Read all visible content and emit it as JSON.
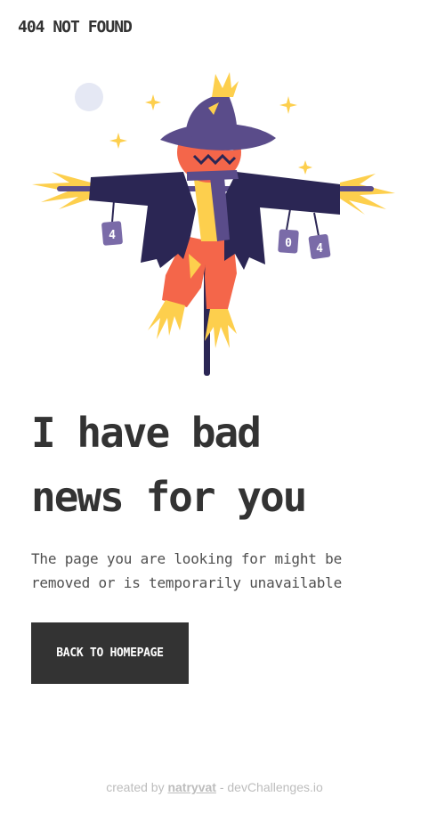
{
  "header": {
    "brand": "404 NOT FOUND"
  },
  "illustration": {
    "can_labels": [
      "4",
      "0",
      "4"
    ]
  },
  "main": {
    "headline_line1": "I have bad",
    "headline_line2": "news for you",
    "description_line1": "The page you are looking for might be",
    "description_line2": "removed or is temporarily unavailable",
    "button_label": "BACK TO HOMEPAGE"
  },
  "footer": {
    "prefix": "created by ",
    "author": "natryvat",
    "suffix": " - devChallenges.io"
  },
  "colors": {
    "text": "#333333",
    "button_bg": "#333333",
    "button_text": "#ffffff",
    "footer_text": "#bdbdbd",
    "coat": "#2b2654",
    "hat": "#5a4c8a",
    "pumpkin": "#f4664a",
    "straw": "#fdcf4d",
    "moon": "#e5e8f4"
  }
}
